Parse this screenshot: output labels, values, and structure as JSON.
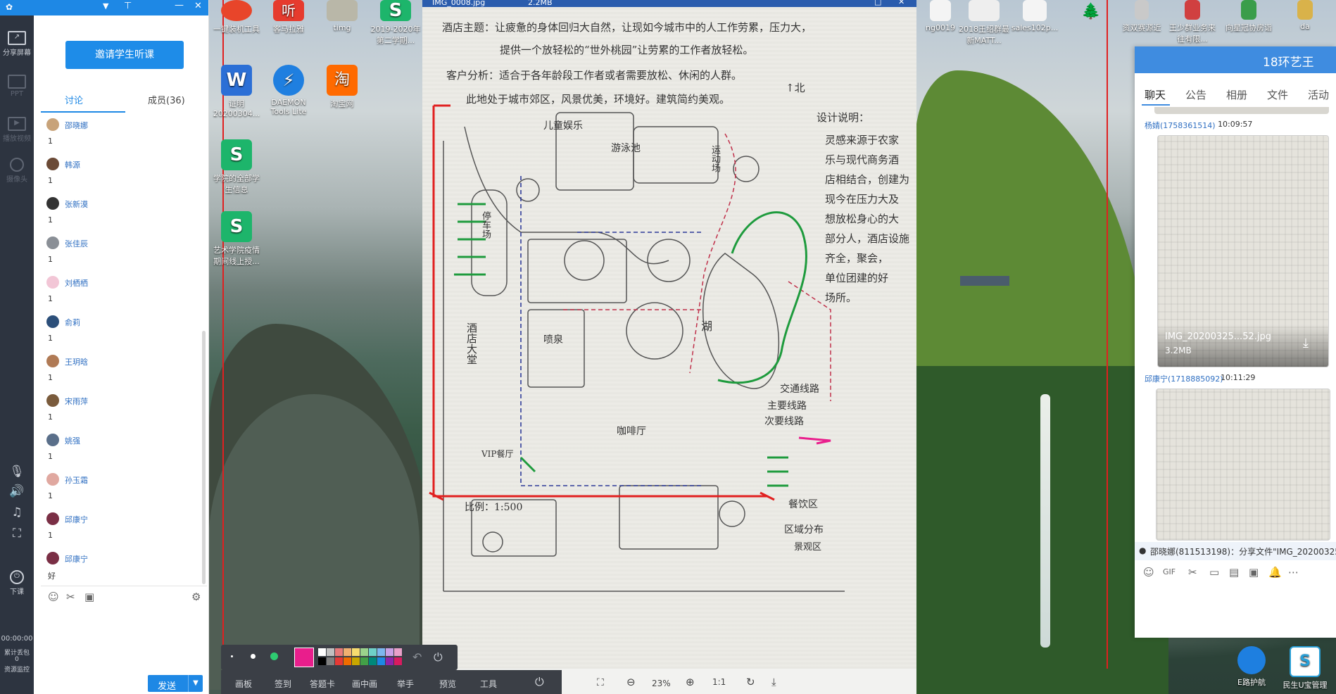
{
  "sidebar": {
    "share": "分享屏幕",
    "ppt": "PPT",
    "video": "播放视频",
    "camera": "摄像头",
    "end": "下课",
    "timer": "00:00:00",
    "packet_loss": "累计丢包",
    "packet_loss_val": "0",
    "monitor": "资源监控"
  },
  "panel": {
    "invite_button": "邀请学生听课",
    "tab_discuss": "讨论",
    "tab_members": "成员(36)",
    "messages": [
      {
        "name": "邵晓娜",
        "text": "1"
      },
      {
        "name": "韩源",
        "text": "1"
      },
      {
        "name": "张新漠",
        "text": "1"
      },
      {
        "name": "张佳辰",
        "text": "1"
      },
      {
        "name": "刘栖栖",
        "text": "1"
      },
      {
        "name": "俞莉",
        "text": "1"
      },
      {
        "name": "王玥晗",
        "text": "1"
      },
      {
        "name": "宋雨萍",
        "text": "1"
      },
      {
        "name": "姚强",
        "text": "1"
      },
      {
        "name": "孙玉霜",
        "text": "1"
      },
      {
        "name": "邱康宁",
        "text": "1"
      },
      {
        "name": "邱康宁",
        "text": "好"
      }
    ],
    "send": "发送"
  },
  "desktop_icons": [
    {
      "label": "一键装机工具"
    },
    {
      "label": "客马拉雅"
    },
    {
      "label": "timg"
    },
    {
      "label": "2019-2020年第二学期..."
    },
    {
      "label": "证明20200304..."
    },
    {
      "label": "DAEMON Tools Lite"
    },
    {
      "label": "淘宝网"
    },
    {
      "label": "学院的全部学生信息"
    },
    {
      "label": "艺术学院疫情期间线上授..."
    },
    {
      "label": "ng0019"
    },
    {
      "label": "2018王绍群最新MATT..."
    },
    {
      "label": "sales102p..."
    },
    {
      "label": "资双赛源近"
    },
    {
      "label": "王少群业务来往有限..."
    },
    {
      "label": "向星冠协房诣"
    },
    {
      "label": "da"
    },
    {
      "label": "E路护航"
    },
    {
      "label": "民生U宝管理"
    }
  ],
  "viewer": {
    "title": "IMG_0008.jpg",
    "size": "2.2MB",
    "zoom": "23%"
  },
  "drawing": {
    "topic_line1": "酒店主题：让疲惫的身体回归大自然，让现如今城市中的人工作劳累，压力大，",
    "topic_line2": "提供一个放轻松的“世外桃园”让劳累的工作者放轻松。",
    "client_line": "客户分析：适合于各年龄段工作者或者需要放松、休闲的人群。",
    "site_line": "此地处于城市郊区，风景优美，环境好。建筑简约美观。",
    "north": "北",
    "design_title": "设计说明：",
    "design_lines": [
      "灵感来源于农家",
      "乐与现代商务酒",
      "店相结合，创建为",
      "现今在压力大及",
      "想放松身心的大",
      "部分人，酒店设施",
      "齐全，聚会，",
      "单位团建的好",
      "场所。"
    ],
    "labels": {
      "entertainment": "儿童娱乐",
      "pool": "游泳池",
      "sport": "运动场",
      "parking": "停车场",
      "hall": "酒店大堂",
      "fountain": "喷泉",
      "lake": "湖",
      "vip": "VIP餐厅",
      "cafe": "咖啡厅",
      "dining": "餐饮区"
    },
    "legend_title": "交通线路",
    "legend_main": "主要线路",
    "legend_sub": "次要线路",
    "zone": "区域分布",
    "zone2": "景观区",
    "scale": "比例：1:500"
  },
  "whiteboard": {
    "items": [
      "画板",
      "签到",
      "答题卡",
      "画中画",
      "举手",
      "预览",
      "工具"
    ],
    "colors": [
      "#ffffff",
      "#c0c0c0",
      "#e87a7a",
      "#f0b070",
      "#f7dc6f",
      "#9bd38c",
      "#6fd1c9",
      "#7db7ef",
      "#c9a0e6",
      "#e9a0c9",
      "#000000",
      "#808080",
      "#e53935",
      "#ef6c00",
      "#c7a600",
      "#43a047",
      "#00897b",
      "#1e88e5",
      "#8e24aa",
      "#d81b60"
    ],
    "active_color": "#e91e8c"
  },
  "group": {
    "title": "18环艺王",
    "tabs": [
      "聊天",
      "公告",
      "相册",
      "文件",
      "活动"
    ],
    "msg1_name": "杨婧",
    "msg1_id": "1758361514",
    "msg1_time": "10:09:57",
    "file_name": "IMG_20200325...52.jpg",
    "file_size": "3.2MB",
    "msg2_name": "邱康宁",
    "msg2_id": "1718885092",
    "msg2_time": "10:11:29",
    "notify": "邵晓娜(811513198)：分享文件\"IMG_20200325"
  }
}
